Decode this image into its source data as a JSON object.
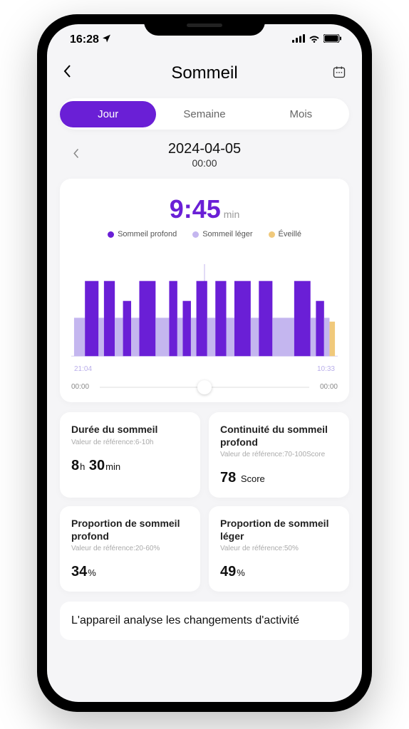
{
  "status": {
    "time": "16:28"
  },
  "nav": {
    "title": "Sommeil"
  },
  "tabs": {
    "day": "Jour",
    "week": "Semaine",
    "month": "Mois"
  },
  "date": {
    "main": "2024-04-05",
    "sub": "00:00"
  },
  "main_card": {
    "total_time": "9:45",
    "total_unit": "min",
    "legend": {
      "deep": {
        "label": "Sommeil profond",
        "color": "#6a1fd6"
      },
      "light": {
        "label": "Sommeil léger",
        "color": "#c4b6ef"
      },
      "awake": {
        "label": "Éveillé",
        "color": "#f0c97b"
      }
    },
    "chart_start": "21:04",
    "chart_end": "10:33",
    "slider_start": "00:00",
    "slider_end": "00:00"
  },
  "stats": {
    "duration": {
      "title": "Durée du sommeil",
      "ref": "Valeur de référence:6-10h",
      "hours": "8",
      "h_unit": "h",
      "mins": "30",
      "m_unit": "min"
    },
    "continuity": {
      "title": "Continuité du sommeil profond",
      "ref": "Valeur de référence:70-100Score",
      "value": "78",
      "unit": "Score"
    },
    "deep_prop": {
      "title": "Proportion de sommeil profond",
      "ref": "Valeur de référence:20-60%",
      "value": "34",
      "unit": "%"
    },
    "light_prop": {
      "title": "Proportion de sommeil léger",
      "ref": "Valeur de référence:50%",
      "value": "49",
      "unit": "%"
    }
  },
  "info": "L'appareil analyse les changements d'activité",
  "chart_data": {
    "type": "bar",
    "xlabel": "",
    "ylabel": "",
    "x_range": [
      "21:04",
      "10:33"
    ],
    "legend": [
      "Sommeil profond",
      "Sommeil léger",
      "Éveillé"
    ],
    "colors": {
      "deep": "#6a1fd6",
      "light": "#c4b6ef",
      "awake": "#f0c97b"
    },
    "segments": [
      {
        "state": "light",
        "height": 0.5,
        "width": 4
      },
      {
        "state": "deep",
        "height": 0.98,
        "width": 5
      },
      {
        "state": "light",
        "height": 0.5,
        "width": 2
      },
      {
        "state": "deep",
        "height": 0.98,
        "width": 4
      },
      {
        "state": "light",
        "height": 0.5,
        "width": 3
      },
      {
        "state": "deep",
        "height": 0.72,
        "width": 3
      },
      {
        "state": "light",
        "height": 0.5,
        "width": 3
      },
      {
        "state": "deep",
        "height": 0.98,
        "width": 6
      },
      {
        "state": "light",
        "height": 0.5,
        "width": 5
      },
      {
        "state": "deep",
        "height": 0.98,
        "width": 3
      },
      {
        "state": "light",
        "height": 0.5,
        "width": 2
      },
      {
        "state": "deep",
        "height": 0.72,
        "width": 3
      },
      {
        "state": "light",
        "height": 0.5,
        "width": 2
      },
      {
        "state": "deep",
        "height": 0.98,
        "width": 4
      },
      {
        "state": "light",
        "height": 0.5,
        "width": 3
      },
      {
        "state": "deep",
        "height": 0.98,
        "width": 4
      },
      {
        "state": "light",
        "height": 0.5,
        "width": 3
      },
      {
        "state": "deep",
        "height": 0.98,
        "width": 6
      },
      {
        "state": "light",
        "height": 0.5,
        "width": 3
      },
      {
        "state": "deep",
        "height": 0.98,
        "width": 5
      },
      {
        "state": "light",
        "height": 0.5,
        "width": 8
      },
      {
        "state": "deep",
        "height": 0.98,
        "width": 6
      },
      {
        "state": "light",
        "height": 0.5,
        "width": 2
      },
      {
        "state": "deep",
        "height": 0.72,
        "width": 3
      },
      {
        "state": "light",
        "height": 0.5,
        "width": 2
      },
      {
        "state": "awake",
        "height": 0.45,
        "width": 2
      }
    ]
  }
}
